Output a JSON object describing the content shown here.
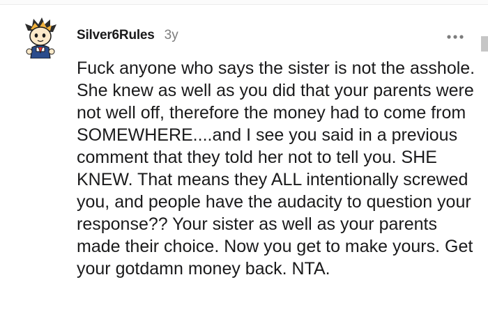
{
  "comment": {
    "author": "Silver6Rules",
    "age": "3y",
    "body": "Fuck anyone who says the sister is not the asshole. She knew as well as you did that your parents were not well off, therefore the money had to come from SOMEWHERE....and I see you said in a previous comment that they told her not to tell you. SHE KNEW. That means they ALL intentionally screwed you, and people have the audacity to question your response?? Your sister as well as your parents made their choice. Now you get to make yours. Get your gotdamn money back. NTA."
  },
  "icons": {
    "avatar": "user-avatar-icon",
    "more": "more-options-icon"
  },
  "colors": {
    "text": "#1a1a1b",
    "muted": "#7c7c7c",
    "background": "#ffffff"
  }
}
